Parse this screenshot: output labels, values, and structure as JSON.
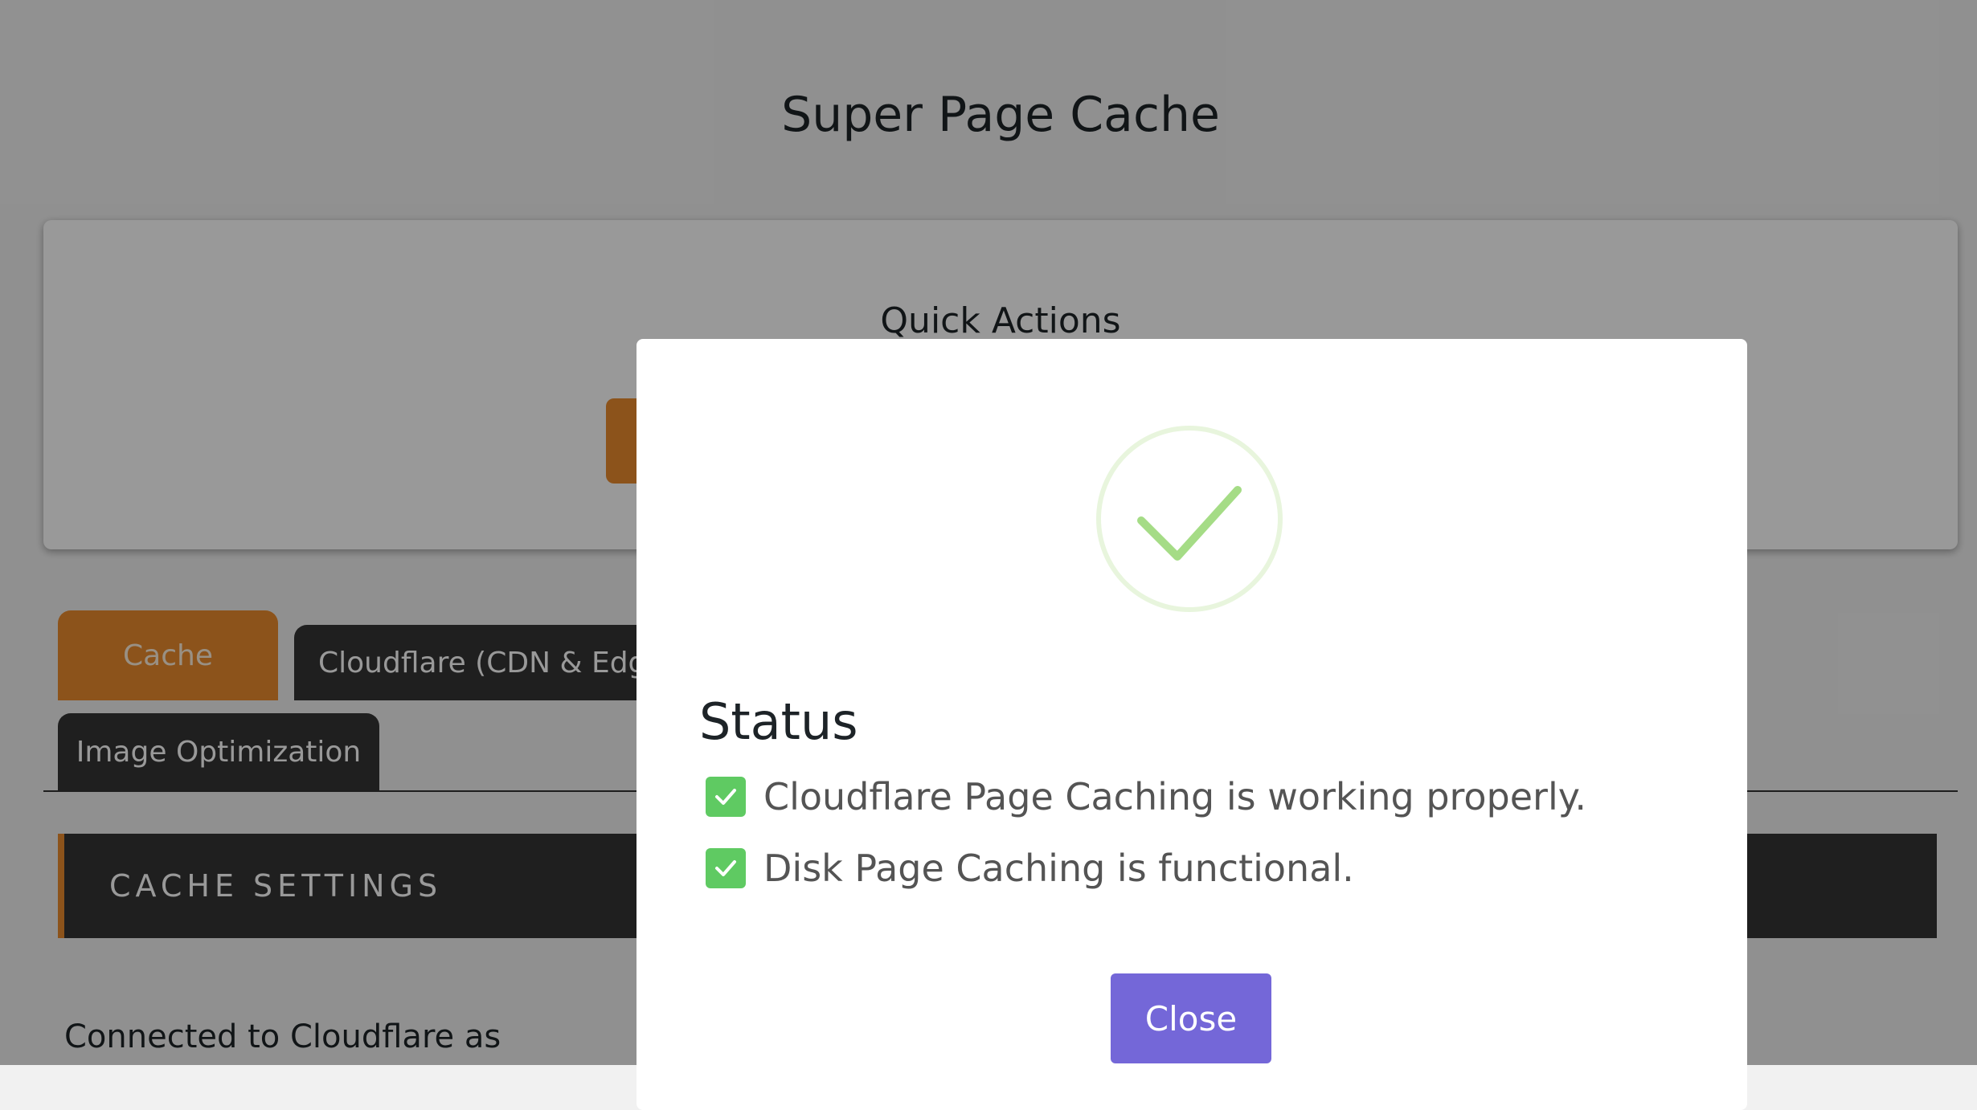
{
  "page": {
    "title": "Super Page Cache"
  },
  "quick_actions": {
    "title": "Quick Actions"
  },
  "tabs": [
    {
      "label": "Cache",
      "active": true
    },
    {
      "label": "Cloudflare (CDN & Edge"
    },
    {
      "label": "Image Optimization"
    }
  ],
  "section": {
    "title": "CACHE SETTINGS"
  },
  "connected": {
    "text": "Connected to Cloudflare as"
  },
  "modal": {
    "icon": "success-check-icon",
    "heading": "Status",
    "items": [
      {
        "text": "Cloudflare Page Caching is working properly.",
        "icon": "check-box-icon"
      },
      {
        "text": "Disk Page Caching is functional.",
        "icon": "check-box-icon"
      }
    ],
    "close_label": "Close"
  },
  "colors": {
    "accent": "#e98b2d",
    "tab_dark": "#343434",
    "success_green": "#5fca62",
    "success_ring": "#e8f5dd",
    "success_check": "#a5dc86",
    "close_button": "#7467d8",
    "overlay": "rgba(0,0,0,0.4)"
  }
}
